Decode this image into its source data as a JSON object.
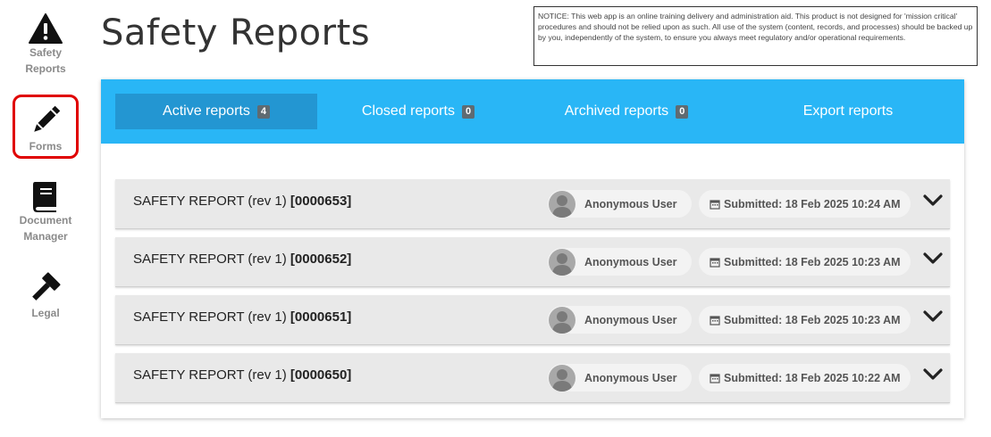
{
  "sidebar": {
    "items": [
      {
        "label_line1": "Safety",
        "label_line2": "Reports",
        "icon": "warning-icon"
      },
      {
        "label_line1": "Forms",
        "label_line2": "",
        "icon": "pencil-icon",
        "active": true
      },
      {
        "label_line1": "Document",
        "label_line2": "Manager",
        "icon": "book-icon"
      },
      {
        "label_line1": "Legal",
        "label_line2": "",
        "icon": "gavel-icon"
      }
    ]
  },
  "page": {
    "title": "Safety Reports",
    "notice": "NOTICE: This web app is an online training delivery and administration aid. This product is not designed for 'mission critical' procedures and should not be relied upon as such. All use of the system (content, records, and processes) should be backed up by you, independently of the system, to ensure you always meet regulatory and/or operational requirements."
  },
  "tabs": [
    {
      "label": "Active reports",
      "count": "4",
      "active": true
    },
    {
      "label": "Closed reports",
      "count": "0"
    },
    {
      "label": "Archived reports",
      "count": "0"
    },
    {
      "label": "Export reports",
      "count": ""
    }
  ],
  "reports": [
    {
      "title": "SAFETY REPORT (rev 1)",
      "id": "[0000653]",
      "user": "Anonymous User",
      "submitted": "Submitted: 18 Feb 2025 10:24 AM"
    },
    {
      "title": "SAFETY REPORT (rev 1)",
      "id": "[0000652]",
      "user": "Anonymous User",
      "submitted": "Submitted: 18 Feb 2025 10:23 AM"
    },
    {
      "title": "SAFETY REPORT (rev 1)",
      "id": "[0000651]",
      "user": "Anonymous User",
      "submitted": "Submitted: 18 Feb 2025 10:23 AM"
    },
    {
      "title": "SAFETY REPORT (rev 1)",
      "id": "[0000650]",
      "user": "Anonymous User",
      "submitted": "Submitted: 18 Feb 2025 10:22 AM"
    }
  ],
  "colors": {
    "tabbar": "#29b6f6",
    "tab_active": "#2396d2",
    "active_outline": "#e00000"
  }
}
